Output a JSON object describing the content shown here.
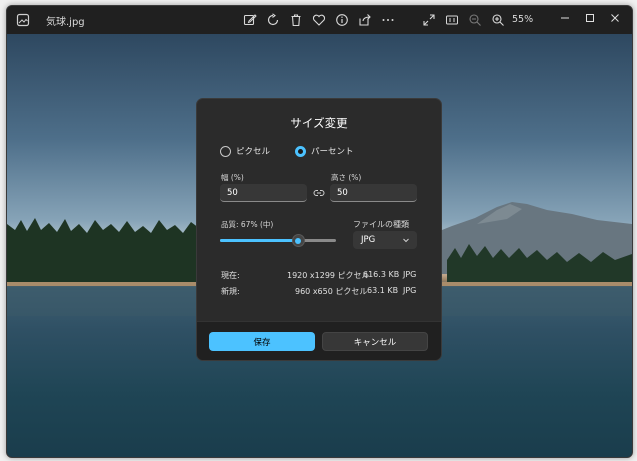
{
  "titlebar": {
    "filename": "気球.jpg",
    "zoom_level": "55%",
    "icons": [
      "app-icon",
      "edit-icon",
      "rotate-icon",
      "delete-icon",
      "favorite-icon",
      "info-icon",
      "share-icon",
      "more-icon",
      "fullscreen-icon",
      "actual-size-icon",
      "zoom-out-icon",
      "zoom-in-icon"
    ]
  },
  "dialog": {
    "title": "サイズ変更",
    "mode_options": [
      {
        "label": "ピクセル",
        "selected": false
      },
      {
        "label": "パーセント",
        "selected": true
      }
    ],
    "width_label": "幅 (%)",
    "width_value": "50",
    "height_label": "高さ (%)",
    "height_value": "50",
    "quality_label": "品質: 67% (中)",
    "quality_value": 67,
    "filetype_label": "ファイルの種類",
    "filetype_value": "JPG",
    "current": {
      "label": "現在:",
      "dimensions": "1920 x1299 ピクセル",
      "size": "616.3 KB",
      "format": "JPG"
    },
    "new": {
      "label": "新規:",
      "dimensions": "960 x650 ピクセル",
      "size": "63.1 KB",
      "format": "JPG"
    },
    "save_label": "保存",
    "cancel_label": "キャンセル"
  },
  "colors": {
    "accent": "#4cc2ff",
    "window_bg": "#202020",
    "dialog_bg": "#2b2b2b"
  }
}
